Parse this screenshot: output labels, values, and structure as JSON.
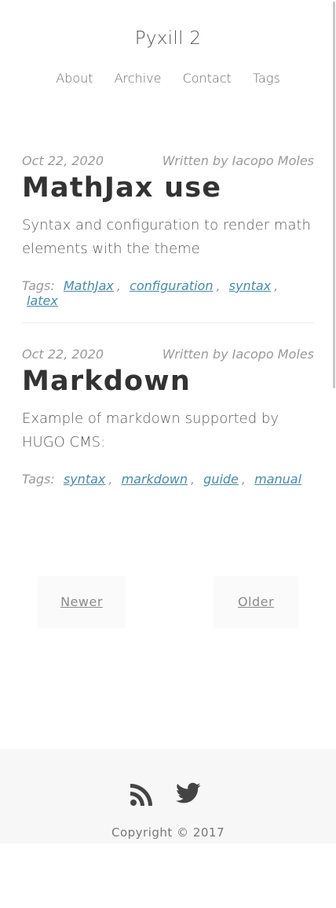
{
  "site": {
    "title": "Pyxill 2"
  },
  "nav": {
    "items": [
      "About",
      "Archive",
      "Contact",
      "Tags"
    ]
  },
  "posts": [
    {
      "date": "Oct 22, 2020",
      "author": "Written by Iacopo Moles",
      "title": "MathJax use",
      "summary": "Syntax and configuration to render math elements with the theme",
      "tags_label": "Tags:",
      "tags": [
        "MathJax",
        "configuration",
        "syntax",
        "latex"
      ]
    },
    {
      "date": "Oct 22, 2020",
      "author": "Written by Iacopo Moles",
      "title": "Markdown",
      "summary": "Example of markdown supported by HUGO CMS:",
      "tags_label": "Tags:",
      "tags": [
        "syntax",
        "markdown",
        "guide",
        "manual"
      ]
    }
  ],
  "pager": {
    "newer": "Newer",
    "older": "Older"
  },
  "footer": {
    "icons": [
      "rss-icon",
      "twitter-icon"
    ],
    "copyright": "Copyright © 2017"
  },
  "colors": {
    "tag_link": "#4a8ba8",
    "footer_bg": "#f7f7f7"
  }
}
